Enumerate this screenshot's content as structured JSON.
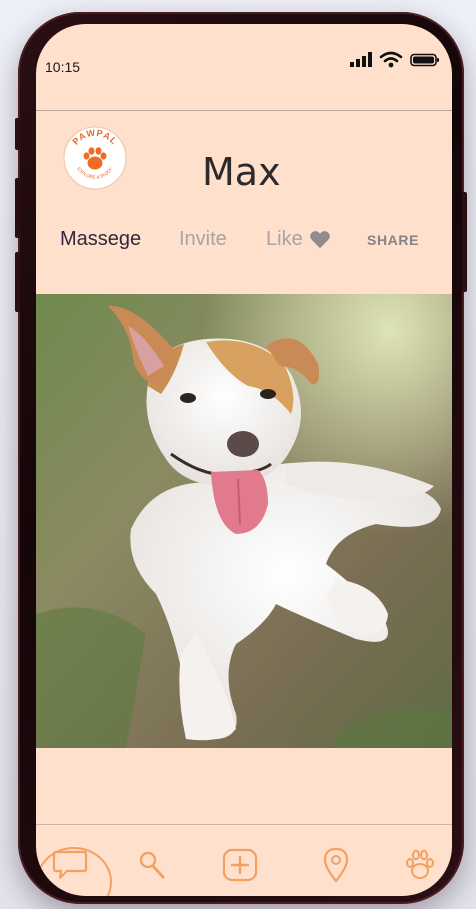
{
  "status_bar": {
    "time": "10:15"
  },
  "logo": {
    "brand": "PAWPAL",
    "tagline": "EXPLORE & ENJOY"
  },
  "profile": {
    "name": "Max"
  },
  "actions": {
    "message_label": "Massege",
    "invite_label": "Invite",
    "like_label": "Like",
    "share_label": "SHARE"
  },
  "photo": {
    "subject": "dog-photo"
  },
  "bottom_nav": {
    "items": [
      {
        "icon": "chat-icon",
        "active": true
      },
      {
        "icon": "search-icon",
        "active": false
      },
      {
        "icon": "add-icon",
        "active": false
      },
      {
        "icon": "location-pin-icon",
        "active": false
      },
      {
        "icon": "paw-icon",
        "active": false
      }
    ]
  },
  "colors": {
    "screen_bg": "#ffe0cc",
    "accent": "#f4a060",
    "frame": "#1c0a0d",
    "text_dark": "#2e2a2c",
    "text_muted": "#a7a3a6"
  }
}
